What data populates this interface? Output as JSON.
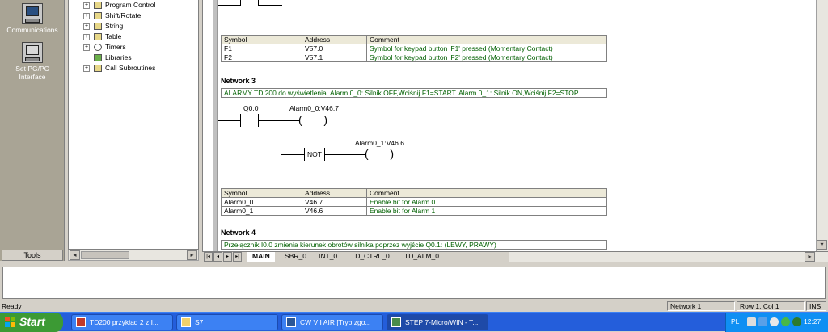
{
  "navbar": {
    "items": [
      {
        "label": "Communications",
        "icon": "communications-icon"
      },
      {
        "label": "Set PG/PC Interface",
        "icon": "pg-pc-interface-icon"
      }
    ],
    "tools_label": "Tools"
  },
  "tree": {
    "items": [
      {
        "label": "Program Control",
        "expandable": true
      },
      {
        "label": "Shift/Rotate",
        "expandable": true
      },
      {
        "label": "String",
        "expandable": true
      },
      {
        "label": "Table",
        "expandable": true
      },
      {
        "label": "Timers",
        "expandable": true
      },
      {
        "label": "Libraries",
        "expandable": false
      },
      {
        "label": "Call Subroutines",
        "expandable": true
      }
    ]
  },
  "symtable_headers": {
    "symbol": "Symbol",
    "address": "Address",
    "comment": "Comment"
  },
  "network2": {
    "rows": [
      {
        "symbol": "F1",
        "address": "V57.0",
        "comment": "Symbol for keypad button 'F1' pressed (Momentary Contact)"
      },
      {
        "symbol": "F2",
        "address": "V57.1",
        "comment": "Symbol for keypad button 'F2' pressed (Momentary Contact)"
      }
    ]
  },
  "network3": {
    "title": "Network 3",
    "comment": "ALARMY TD 200 do wyświetlenia. Alarm 0_0: Silnik OFF,Wciśnij F1=START. Alarm 0_1: Silnik ON,Wciśnij F2=STOP",
    "contact": "Q0.0",
    "coil1": "Alarm0_0:V46.7",
    "coil2": "Alarm0_1:V46.6",
    "not_label": "NOT",
    "rows": [
      {
        "symbol": "Alarm0_0",
        "address": "V46.7",
        "comment": "Enable bit for Alarm  0"
      },
      {
        "symbol": "Alarm0_1",
        "address": "V46.6",
        "comment": "Enable bit for Alarm  1"
      }
    ]
  },
  "network4": {
    "title": "Network 4",
    "comment": "Przełącznik I0.0 zmienia kierunek obrotów silnika poprzez wyjście Q0.1: (LEWY, PRAWY)"
  },
  "tabs": [
    "MAIN",
    "SBR_0",
    "INT_0",
    "TD_CTRL_0",
    "TD_ALM_0"
  ],
  "active_tab": "MAIN",
  "status": {
    "left": "Ready",
    "network": "Network 1",
    "position": "Row 1, Col 1",
    "mode": "INS"
  },
  "taskbar": {
    "start_label": "Start",
    "tasks": [
      {
        "label": "TD200 przykład 2 z I...",
        "icon": "pdf-icon"
      },
      {
        "label": "S7",
        "icon": "folder-icon"
      },
      {
        "label": "CW VII AIR [Tryb zgo...",
        "icon": "document-icon"
      },
      {
        "label": "STEP 7-Micro/WIN - T...",
        "icon": "step7-icon"
      }
    ],
    "language": "PL",
    "clock": "12:27"
  },
  "colors": {
    "navbar_bg": "#a9a495",
    "comment_green": "#006000",
    "taskbar_blue": "#245edb",
    "start_green": "#3c9a34"
  }
}
